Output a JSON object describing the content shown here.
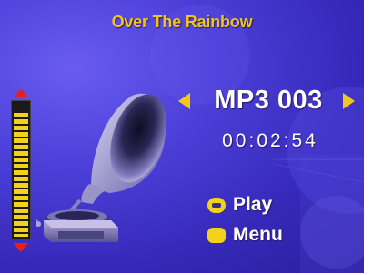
{
  "song_title": "Over The Rainbow",
  "track": {
    "name": "MP3 003",
    "elapsed": "00:02:54"
  },
  "volume": {
    "level": 0.93
  },
  "softkeys": {
    "play_label": "Play",
    "menu_label": "Menu"
  },
  "icons": {
    "volume_up": "triangle-up-icon",
    "volume_down": "triangle-down-icon",
    "prev": "triangle-left-icon",
    "next": "triangle-right-icon",
    "play": "rounded-key-icon",
    "menu": "rounded-key-icon",
    "illustration": "gramophone-icon"
  },
  "colors": {
    "accent_yellow": "#f3c715",
    "arrow_red": "#e22222",
    "background": "#3b30c8",
    "text": "#ffffff"
  }
}
